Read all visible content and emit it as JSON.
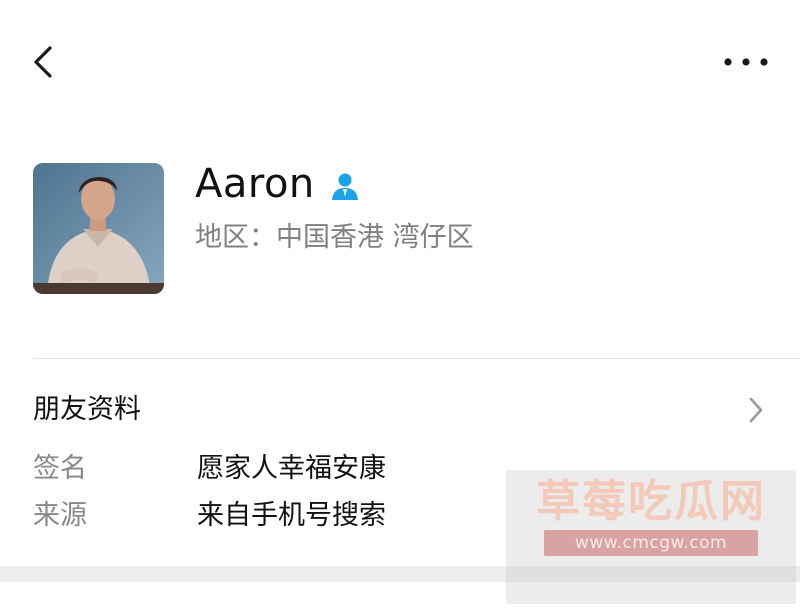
{
  "header": {
    "back_icon": "chevron-left-icon",
    "more_icon": "more-horizontal-icon"
  },
  "profile": {
    "name": "Aaron",
    "badge_icon": "user-icon",
    "badge_color": "#1aa3e8",
    "region": "地区：中国香港 湾仔区"
  },
  "friend_info": {
    "title": "朋友资料",
    "chevron_icon": "chevron-right-icon",
    "rows": [
      {
        "label": "签名",
        "value": "愿家人幸福安康"
      },
      {
        "label": "来源",
        "value": "来自手机号搜索"
      }
    ]
  },
  "watermark": {
    "title": "草莓吃瓜网",
    "url": "www.cmcgw.com"
  }
}
